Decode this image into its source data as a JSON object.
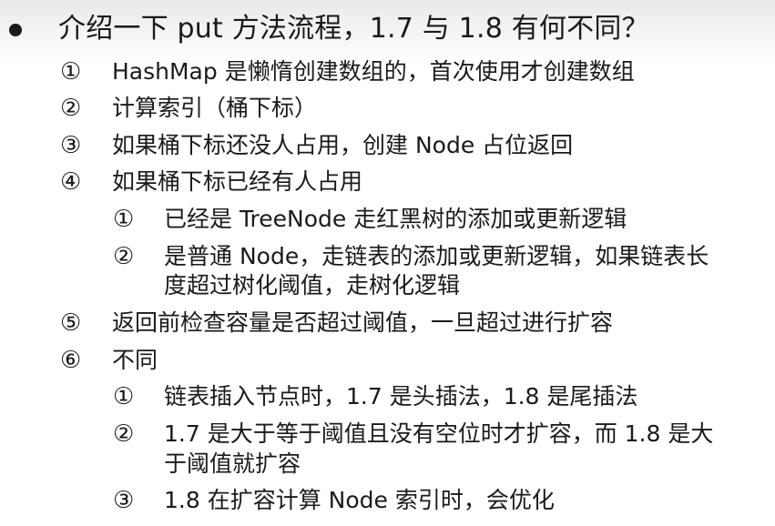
{
  "title": "介绍一下 put 方法流程，1.7 与 1.8 有何不同？",
  "items": [
    {
      "num": "①",
      "text": "HashMap 是懒惰创建数组的，首次使用才创建数组"
    },
    {
      "num": "②",
      "text": "计算索引（桶下标）"
    },
    {
      "num": "③",
      "text": "如果桶下标还没人占用，创建 Node 占位返回"
    },
    {
      "num": "④",
      "text": "如果桶下标已经有人占用"
    },
    {
      "num": "①",
      "text": "已经是 TreeNode 走红黑树的添加或更新逻辑"
    },
    {
      "num": "②",
      "text": "是普通 Node，走链表的添加或更新逻辑，如果链表长",
      "cont": "度超过树化阈值，走树化逻辑"
    },
    {
      "num": "⑤",
      "text": "返回前检查容量是否超过阈值，一旦超过进行扩容"
    },
    {
      "num": "⑥",
      "text": "不同"
    },
    {
      "num": "①",
      "text": "链表插入节点时，1.7 是头插法，1.8 是尾插法"
    },
    {
      "num": "②",
      "text": "1.7 是大于等于阈值且没有空位时才扩容，而 1.8 是大",
      "cont": "于阈值就扩容"
    },
    {
      "num": "③",
      "text": "1.8 在扩容计算 Node 索引时，会优化"
    }
  ]
}
